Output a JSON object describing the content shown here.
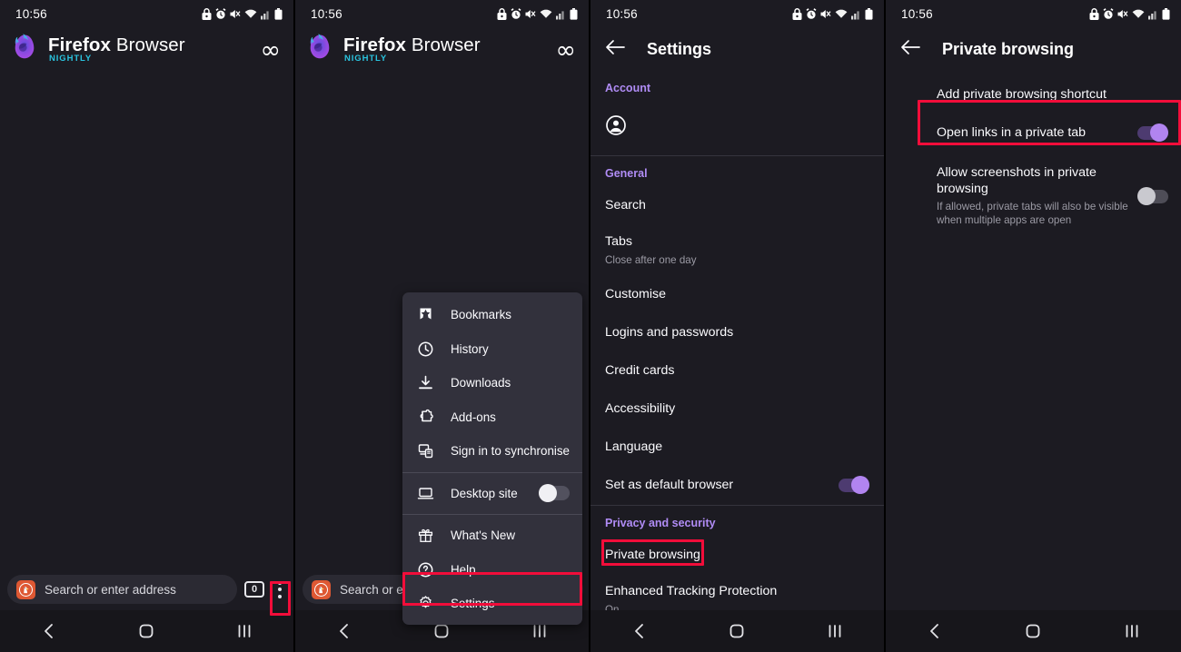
{
  "status_bar": {
    "time": "10:56",
    "icons": [
      "lock-icon",
      "alarm-icon",
      "mute-icon",
      "wifi-icon",
      "signal-icon",
      "battery-icon"
    ]
  },
  "brand": {
    "name_bold": "Firefox",
    "name_rest": " Browser",
    "channel": "NIGHTLY",
    "logo_icon": "firefox-nightly-logo",
    "infinity_icon": "∞"
  },
  "toolbar": {
    "search_placeholder": "Search or enter address",
    "search_placeholder_clipped": "Search or ente",
    "engine_icon": "duckduckgo-icon",
    "tab_count": "0",
    "menu_icon": "three-dot-menu-icon"
  },
  "navbar": {
    "back_icon": "back-chevron-icon",
    "home_icon": "home-square-icon",
    "recents_icon": "recent-apps-icon"
  },
  "menu": {
    "items": [
      {
        "label": "Bookmarks",
        "icon": "bookmark-star-icon"
      },
      {
        "label": "History",
        "icon": "clock-icon"
      },
      {
        "label": "Downloads",
        "icon": "download-arrow-icon"
      },
      {
        "label": "Add-ons",
        "icon": "puzzle-piece-icon"
      },
      {
        "label": "Sign in to synchronise",
        "icon": "sync-device-icon"
      },
      {
        "label": "Desktop site",
        "icon": "laptop-icon",
        "toggle": "off"
      },
      {
        "label": "What's New",
        "icon": "gift-icon"
      },
      {
        "label": "Help",
        "icon": "question-circle-icon"
      },
      {
        "label": "Settings",
        "icon": "gear-icon",
        "highlighted": true
      }
    ]
  },
  "settings_page": {
    "title": "Settings",
    "back_icon": "back-arrow-icon",
    "sections": [
      {
        "heading": "Account",
        "rows": [
          {
            "icon": "account-avatar-icon",
            "label": ""
          }
        ]
      },
      {
        "heading": "General",
        "rows": [
          {
            "label": "Search"
          },
          {
            "label": "Tabs",
            "sub": "Close after one day"
          },
          {
            "label": "Customise"
          },
          {
            "label": "Logins and passwords"
          },
          {
            "label": "Credit cards"
          },
          {
            "label": "Accessibility"
          },
          {
            "label": "Language"
          },
          {
            "label": "Set as default browser",
            "toggle": "on"
          }
        ]
      },
      {
        "heading": "Privacy and security",
        "rows": [
          {
            "label": "Private browsing",
            "highlighted": true
          },
          {
            "label": "Enhanced Tracking Protection",
            "sub": "On"
          }
        ]
      }
    ]
  },
  "private_browsing_page": {
    "title": "Private browsing",
    "back_icon": "back-arrow-icon",
    "rows": [
      {
        "label": "Add private browsing shortcut"
      },
      {
        "label": "Open links in a private tab",
        "toggle": "on",
        "highlighted": true
      },
      {
        "label": "Allow screenshots in private browsing",
        "sub": "If allowed, private tabs will also be visible when multiple apps are open",
        "toggle": "off"
      }
    ]
  },
  "colors": {
    "background": "#1c1b22",
    "menu_background": "#32313c",
    "accent_purple": "#b08cf5",
    "toggle_on": "#b184f0",
    "highlight_red": "#f20d3a",
    "nightly_cyan": "#2ac3de"
  }
}
